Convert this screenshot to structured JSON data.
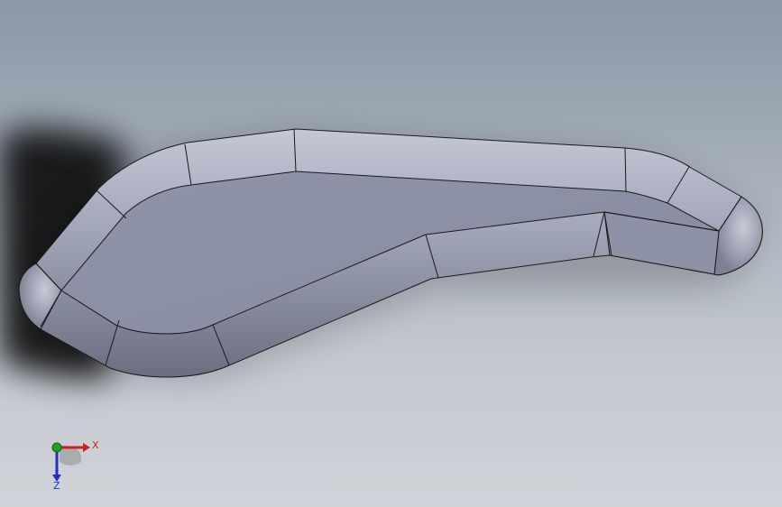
{
  "viewport": {
    "model": "3d-part-model",
    "colors": {
      "background_top": "#8a97a6",
      "background_bottom": "#d0d3d8",
      "part_face": "#8b90a4",
      "part_edge_light": "#b9bdcb",
      "part_edge_dark": "#5d6172",
      "edge_line": "#1a1a1a"
    }
  },
  "triad": {
    "x_label": "X",
    "z_label": "Z",
    "colors": {
      "x_axis": "#cc2020",
      "y_axis": "#20a020",
      "z_axis": "#2030c0"
    }
  }
}
